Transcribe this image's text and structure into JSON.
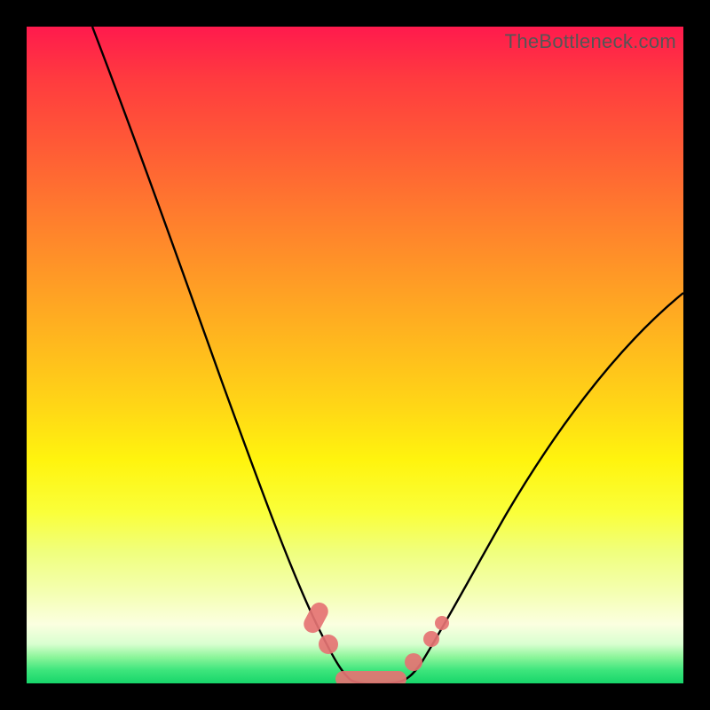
{
  "watermark": "TheBottleneck.com",
  "chart_data": {
    "type": "line",
    "title": "",
    "xlabel": "",
    "ylabel": "",
    "xlim": [
      0,
      100
    ],
    "ylim": [
      0,
      100
    ],
    "series": [
      {
        "name": "bottleneck-curve",
        "x": [
          10,
          15,
          20,
          25,
          30,
          35,
          40,
          45,
          48,
          50,
          52,
          55,
          58,
          60,
          65,
          70,
          75,
          80,
          85,
          90,
          95,
          100
        ],
        "y": [
          100,
          88,
          76,
          64,
          52,
          40,
          28,
          14,
          5,
          0,
          0,
          0,
          3,
          7,
          15,
          23,
          31,
          38,
          44,
          50,
          55,
          60
        ]
      }
    ],
    "markers": [
      {
        "name": "left-cluster-1",
        "x": 44,
        "y": 10
      },
      {
        "name": "left-cluster-2",
        "x": 45,
        "y": 6
      },
      {
        "name": "trough-left",
        "x": 48,
        "y": 0
      },
      {
        "name": "trough-mid",
        "x": 52,
        "y": 0
      },
      {
        "name": "trough-right",
        "x": 56,
        "y": 0
      },
      {
        "name": "right-dot-1",
        "x": 59,
        "y": 5
      },
      {
        "name": "right-dot-2",
        "x": 61,
        "y": 9
      }
    ],
    "background_gradient": {
      "top": "#ff1a4d",
      "mid": "#ffe710",
      "bottom": "#17d66a"
    }
  }
}
